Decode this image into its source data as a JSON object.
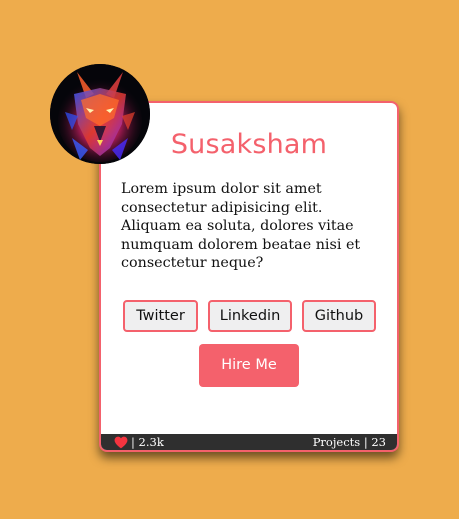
{
  "profile": {
    "name": "Susaksham",
    "bio": "Lorem ipsum dolor sit amet consectetur adipisicing elit. Aliquam ea soluta, dolores vitae numquam dolorem beatae nisi et consectetur neque?",
    "avatar_icon": "wolf-avatar-icon"
  },
  "buttons": {
    "twitter": "Twitter",
    "linkedin": "Linkedin",
    "github": "Github",
    "hire": "Hire Me"
  },
  "footer": {
    "likes": "| 2.3k",
    "projects": "Projects | 23",
    "like_icon": "heart-icon"
  },
  "colors": {
    "background": "#EEAC4C",
    "accent": "#F4616C",
    "footer": "#2F2F2F",
    "heart": "#F4343F"
  }
}
